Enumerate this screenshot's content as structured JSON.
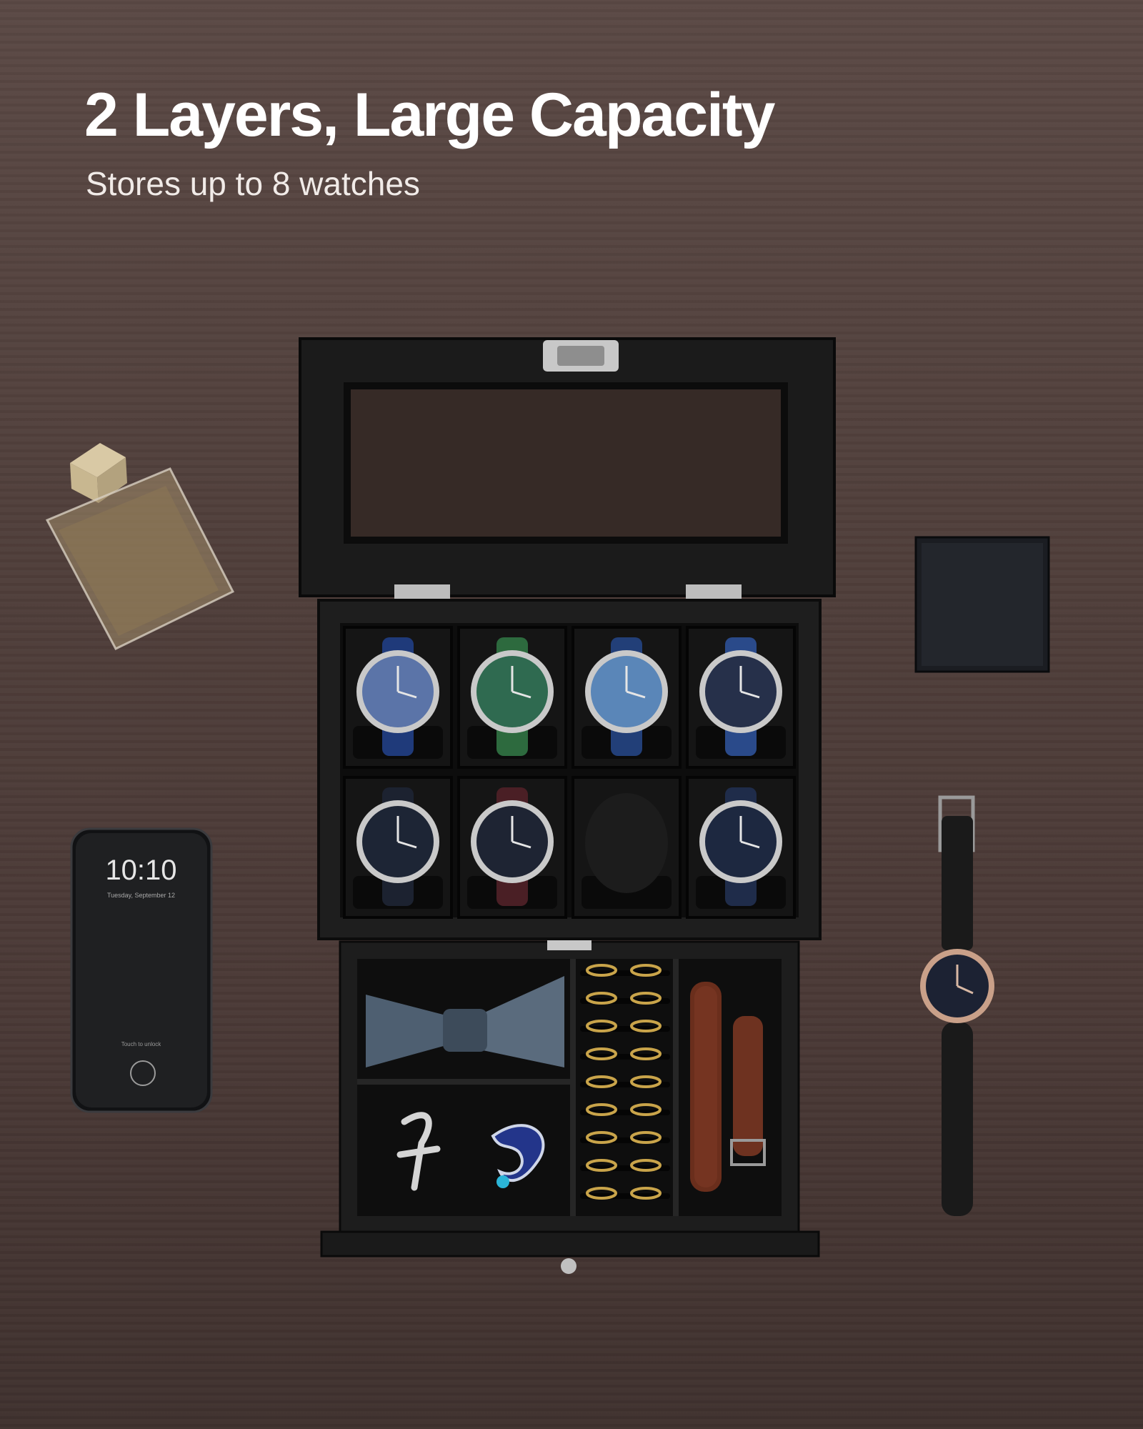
{
  "headline": {
    "title": "2 Layers, Large Capacity",
    "subtitle": "Stores up to 8 watches"
  },
  "phone": {
    "time": "10:10",
    "date": "Tuesday, September 12",
    "unlock_hint": "Touch to unlock"
  },
  "watch_slots": [
    {
      "dial": "#5b74a8",
      "strap": "#1f3a7a"
    },
    {
      "dial": "#2f6a50",
      "strap": "#2d6a3e"
    },
    {
      "dial": "#5a86b8",
      "strap": "#223f78"
    },
    {
      "dial": "#26304a",
      "strap": "#2a4a8a"
    },
    {
      "dial": "#1d2535",
      "strap": "#1c2230"
    },
    {
      "dial": "#1e2433",
      "strap": "#4a1f25"
    },
    {
      "dial": null,
      "strap": null
    },
    {
      "dial": "#1d2840",
      "strap": "#1f2c4a"
    }
  ],
  "colors": {
    "wood": "#4f3e3a",
    "box": "#1c1c1c",
    "velvet": "#0f0f0f",
    "metal": "#b8b8b8",
    "gold": "#c9a44a"
  }
}
